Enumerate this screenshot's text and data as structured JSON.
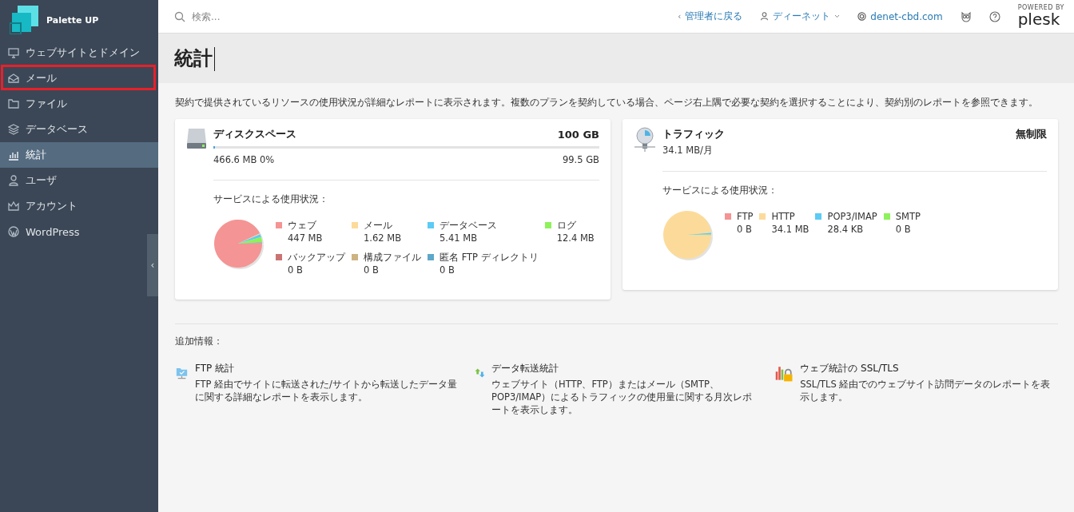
{
  "sidebar": {
    "brand": "Palette UP",
    "items": [
      {
        "label": "ウェブサイトとドメイン",
        "selected": false,
        "highlighted": false
      },
      {
        "label": "メール",
        "selected": false,
        "highlighted": true
      },
      {
        "label": "ファイル",
        "selected": false,
        "highlighted": false
      },
      {
        "label": "データベース",
        "selected": false,
        "highlighted": false
      },
      {
        "label": "統計",
        "selected": true,
        "highlighted": false
      },
      {
        "label": "ユーザ",
        "selected": false,
        "highlighted": false
      },
      {
        "label": "アカウント",
        "selected": false,
        "highlighted": false
      },
      {
        "label": "WordPress",
        "selected": false,
        "highlighted": false
      }
    ],
    "collapse": "‹"
  },
  "topbar": {
    "search": {
      "placeholder": "検索..."
    },
    "back": {
      "arrow": "‹",
      "label": "管理者に戻る"
    },
    "user": "ディーネット",
    "domain": "denet-cbd.com",
    "powered_by": "POWERED BY",
    "brand": "plesk"
  },
  "page": {
    "title": "統計",
    "description": "契約で提供されているリソースの使用状況が詳細なレポートに表示されます。複数のプランを契約している場合、ページ右上隅で必要な契約を選択することにより、契約別のレポートを参照できます。"
  },
  "disk": {
    "title": "ディスクスペース",
    "total": "100 GB",
    "used": "466.6 MB 0%",
    "free": "99.5 GB",
    "level": 0.005,
    "usage_label": "サービスによる使用状況：",
    "legend": [
      {
        "label": "ウェブ",
        "reading": "447 MB",
        "color": "#f59494"
      },
      {
        "label": "メール",
        "reading": "1.62 MB",
        "color": "#fcdb9a"
      },
      {
        "label": "データベース",
        "reading": "5.41 MB",
        "color": "#5ccbf5"
      },
      {
        "label": "ログ",
        "reading": "12.4 MB",
        "color": "#8ef25a"
      },
      {
        "label": "バックアップ",
        "reading": "0 B",
        "color": "#c97474"
      },
      {
        "label": "構成ファイル",
        "reading": "0 B",
        "color": "#cdb382"
      },
      {
        "label": "匿名 FTP ディレクトリ",
        "reading": "0 B",
        "color": "#5ea7c9"
      }
    ]
  },
  "traffic": {
    "title": "トラフィック",
    "limit": "無制限",
    "used": "34.1 MB/月",
    "usage_label": "サービスによる使用状況：",
    "legend": [
      {
        "label": "FTP",
        "reading": "0 B",
        "color": "#f59494"
      },
      {
        "label": "HTTP",
        "reading": "34.1 MB",
        "color": "#fcdb9a"
      },
      {
        "label": "POP3/IMAP",
        "reading": "28.4 KB",
        "color": "#5ccbf5"
      },
      {
        "label": "SMTP",
        "reading": "0 B",
        "color": "#8ef25a"
      }
    ]
  },
  "extra": {
    "heading": "追加情報：",
    "items": [
      {
        "kind": "ftp",
        "title": "FTP 統計",
        "text": "FTP 経由でサイトに転送された/サイトから転送したデータ量に関する詳細なレポートを表示します。"
      },
      {
        "kind": "transfer",
        "title": "データ転送統計",
        "text": "ウェブサイト（HTTP、FTP）またはメール（SMTP、POP3/IMAP）によるトラフィックの使用量に関する月次レポートを表示します。"
      },
      {
        "kind": "ssl",
        "title": "ウェブ統計の SSL/TLS",
        "text": "SSL/TLS 経由でのウェブサイト訪問データのレポートを表示します。"
      }
    ]
  }
}
